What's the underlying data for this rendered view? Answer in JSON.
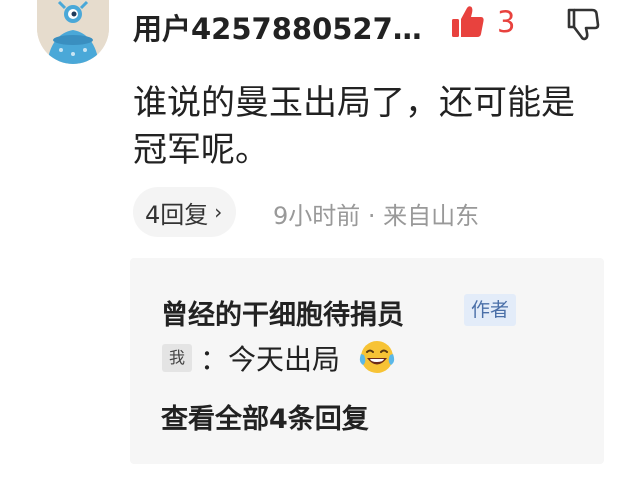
{
  "comment": {
    "username": "用户4257880527…",
    "like_count": "3",
    "text": "谁说的曼玉出局了，还可能是冠军呢。",
    "replies_label": "4回复",
    "replies_chevron": "›",
    "meta": "9小时前 · 来自山东"
  },
  "reply": {
    "author": "曾经的干细胞待捐员",
    "author_tag": "作者",
    "me_badge": "我",
    "text": "：今天出局",
    "view_all": "查看全部4条回复"
  },
  "colors": {
    "like_active": "#e8423e",
    "meta_gray": "#999999",
    "tag_blue": "#4a6fa8"
  },
  "icons": {
    "avatar": "alien-avatar",
    "like": "thumbs-up-icon",
    "dislike": "thumbs-down-icon",
    "emoji": "laughing-tears-emoji"
  }
}
